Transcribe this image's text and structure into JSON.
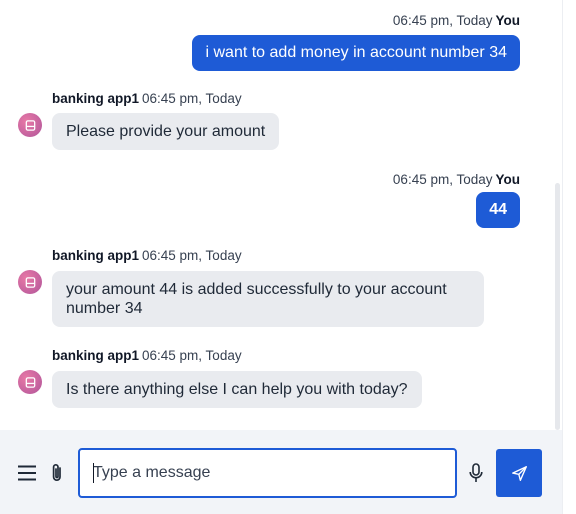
{
  "messages": [
    {
      "sender": "You",
      "time": "06:45 pm, Today",
      "text": "i want to add money in account number 34"
    },
    {
      "sender": "banking app1",
      "time": "06:45 pm, Today",
      "text": "Please provide your amount"
    },
    {
      "sender": "You",
      "time": "06:45 pm, Today",
      "text": "44"
    },
    {
      "sender": "banking app1",
      "time": "06:45 pm, Today",
      "text": "your amount 44 is added successfully to your account number 34"
    },
    {
      "sender": "banking app1",
      "time": "06:45 pm, Today",
      "text": "Is there anything else I can help you with today?"
    }
  ],
  "composer": {
    "placeholder": "Type a message",
    "menu_icon": "hamburger-menu-icon",
    "attach_icon": "paperclip-icon",
    "mic_icon": "microphone-icon",
    "send_icon": "send-icon"
  },
  "colors": {
    "user_bubble": "#1e5bd6",
    "bot_bubble": "#e9ebef",
    "avatar": "#c764a0",
    "composer_bg": "#f2f4f8"
  }
}
